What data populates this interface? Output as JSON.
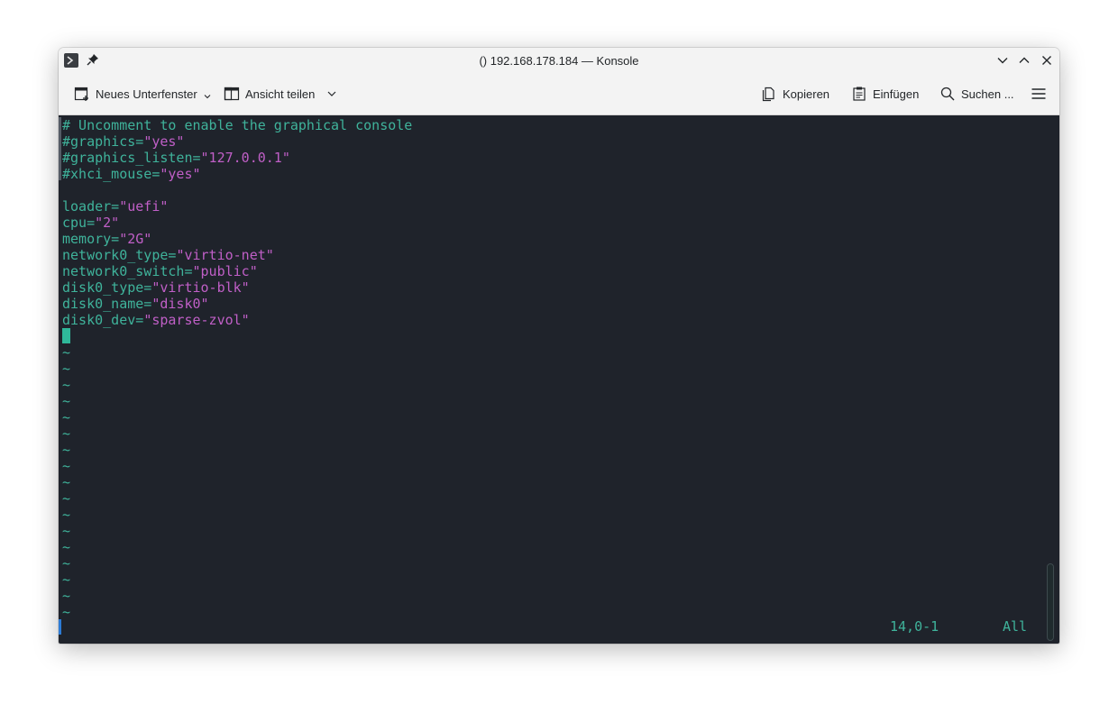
{
  "window": {
    "title": "() 192.168.178.184 — Konsole"
  },
  "toolbar": {
    "new_split": "Neues Unterfenster",
    "split_view": "Ansicht teilen",
    "copy": "Kopieren",
    "paste": "Einfügen",
    "search": "Suchen ..."
  },
  "terminal": {
    "lines": [
      {
        "key": "",
        "value": "# Uncomment to enable the graphical console"
      },
      {
        "key": "#graphics=",
        "value": "\"yes\""
      },
      {
        "key": "#graphics_listen=",
        "value": "\"127.0.0.1\""
      },
      {
        "key": "#xhci_mouse=",
        "value": "\"yes\""
      },
      {
        "key": "",
        "value": ""
      },
      {
        "key": "loader=",
        "value": "\"uefi\""
      },
      {
        "key": "cpu=",
        "value": "\"2\""
      },
      {
        "key": "memory=",
        "value": "\"2G\""
      },
      {
        "key": "network0_type=",
        "value": "\"virtio-net\""
      },
      {
        "key": "network0_switch=",
        "value": "\"public\""
      },
      {
        "key": "disk0_type=",
        "value": "\"virtio-blk\""
      },
      {
        "key": "disk0_name=",
        "value": "\"disk0\""
      },
      {
        "key": "disk0_dev=",
        "value": "\"sparse-zvol\""
      }
    ],
    "tilde": "~",
    "tilde_count": 17,
    "cursor_position": "14,0-1",
    "scroll_position": "All"
  },
  "colors": {
    "terminal_bg": "#1f232b",
    "text_teal": "#3fb39b",
    "string_purple": "#c05fc7",
    "cursor": "#2fb89a"
  }
}
